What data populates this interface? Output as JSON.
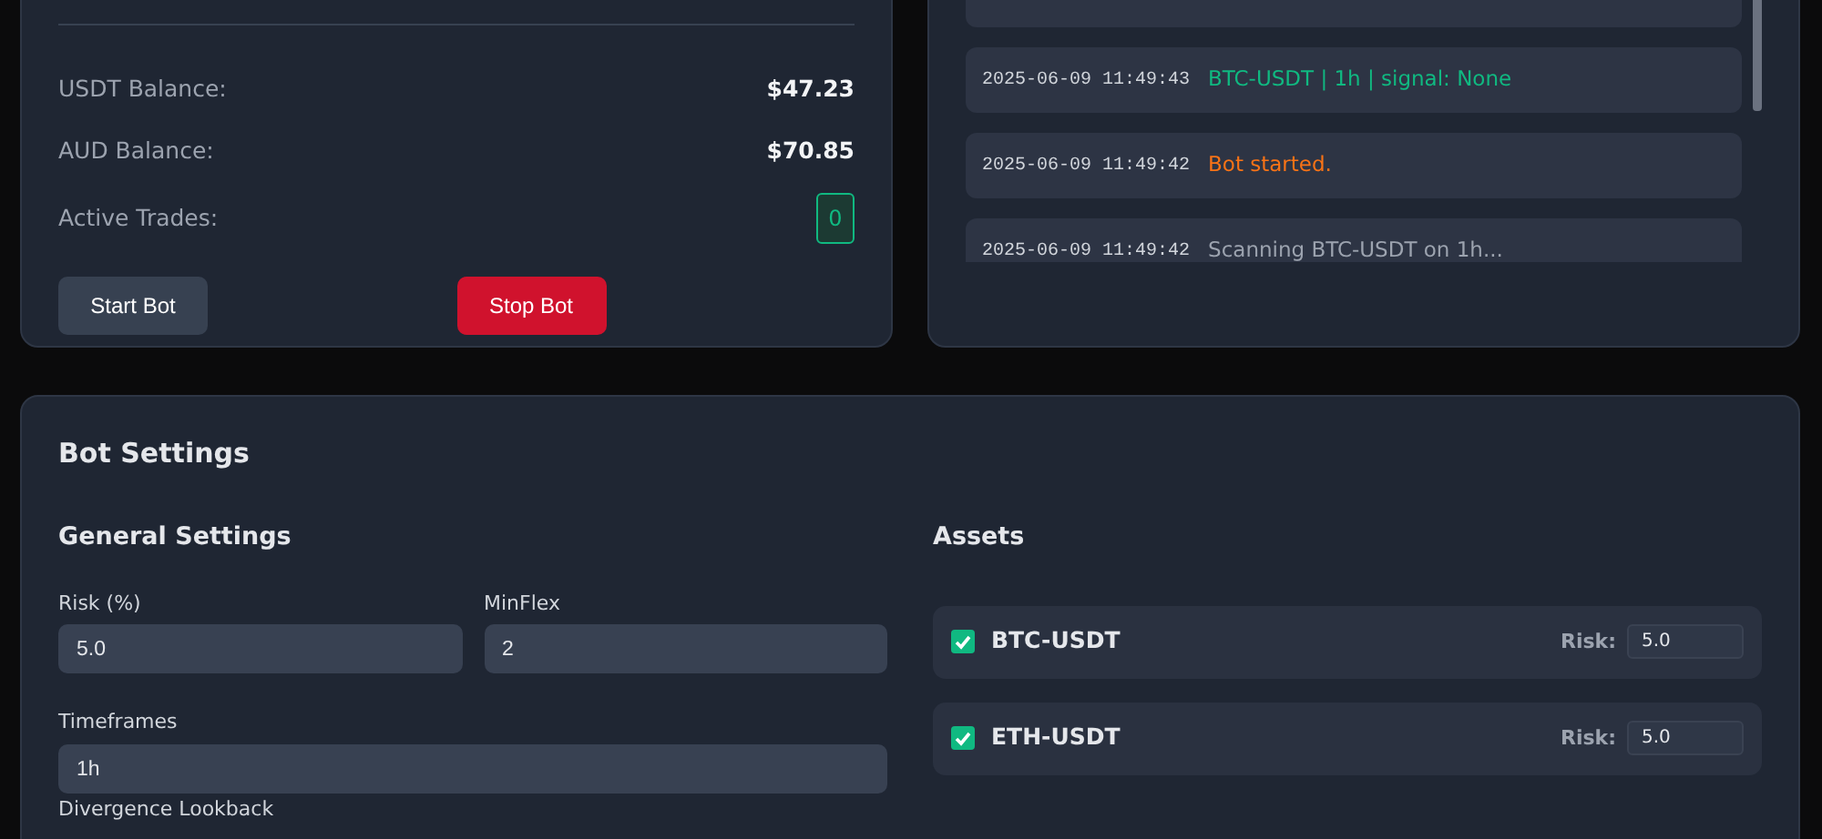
{
  "balances": [
    {
      "label": "USDT Balance:",
      "value": "$47.23"
    },
    {
      "label": "AUD Balance:",
      "value": "$70.85"
    }
  ],
  "active_trades": {
    "label": "Active Trades:",
    "value": "0"
  },
  "buttons": [
    {
      "label": "Start Bot",
      "kind": "start"
    },
    {
      "label": "Stop Bot",
      "kind": "stop"
    }
  ],
  "log": [
    {
      "time": "2025-06-09 11:49:43",
      "message": "BTC-USDT | 1h | signal: None",
      "kind": "success"
    },
    {
      "time": "2025-06-09 11:49:42",
      "message": "Bot started.",
      "kind": "warning"
    },
    {
      "time": "2025-06-09 11:49:42",
      "message": "Scanning BTC-USDT on 1h...",
      "kind": "info"
    }
  ],
  "settings": {
    "title": "Bot Settings",
    "general": {
      "title": "General Settings",
      "fields": [
        {
          "label": "Risk (%)",
          "value": "5.0",
          "kind": "half"
        },
        {
          "label": "MinFlex",
          "value": "2",
          "kind": "half"
        },
        {
          "label": "Timeframes",
          "value": "1h",
          "kind": "full"
        }
      ],
      "next_label": "Divergence Lookback"
    },
    "assets": {
      "title": "Assets",
      "items": [
        {
          "name": "BTC-USDT",
          "checked": true,
          "risk_label": "Risk:",
          "risk": "5.0"
        },
        {
          "name": "ETH-USDT",
          "checked": true,
          "risk_label": "Risk:",
          "risk": "5.0"
        }
      ]
    }
  }
}
